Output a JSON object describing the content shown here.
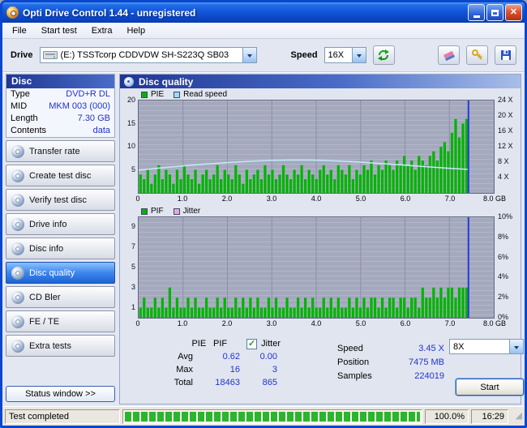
{
  "window": {
    "title": "Opti Drive Control 1.44  -  unregistered"
  },
  "menu": {
    "items": [
      "File",
      "Start test",
      "Extra",
      "Help"
    ]
  },
  "toolbar": {
    "drive_label": "Drive",
    "drive_value": "(E:)  TSSTcorp CDDVDW SH-S223Q SB03",
    "speed_label": "Speed",
    "speed_value": "16X"
  },
  "sidebar": {
    "section_header": "Disc",
    "info": [
      {
        "label": "Type",
        "value": "DVD+R DL"
      },
      {
        "label": "MID",
        "value": "MKM 003 (000)"
      },
      {
        "label": "Length",
        "value": "7.30 GB"
      },
      {
        "label": "Contents",
        "value": "data"
      }
    ],
    "buttons": [
      "Transfer rate",
      "Create test disc",
      "Verify test disc",
      "Drive info",
      "Disc info",
      "Disc quality",
      "CD Bler",
      "FE / TE",
      "Extra tests"
    ],
    "active_button": "Disc quality",
    "status_window_button": "Status window >>"
  },
  "main": {
    "header": "Disc quality"
  },
  "chart_data": [
    {
      "type": "bar",
      "legend": [
        {
          "label": "PIE",
          "color": "#00B400"
        },
        {
          "label": "Read speed",
          "color": "#9ADCF5"
        }
      ],
      "x_ticks": [
        "0",
        "1.0",
        "2.0",
        "3.0",
        "4.0",
        "5.0",
        "6.0",
        "7.0",
        "8.0 GB"
      ],
      "xlim": [
        0,
        8
      ],
      "left_max": 20,
      "left_ticks": [
        {
          "label": "20",
          "v": 20
        },
        {
          "label": "15",
          "v": 15
        },
        {
          "label": "10",
          "v": 10
        },
        {
          "label": "5",
          "v": 5
        }
      ],
      "right_max": 24,
      "right_ticks": [
        {
          "label": "24 X",
          "v": 24
        },
        {
          "label": "20 X",
          "v": 20
        },
        {
          "label": "16 X",
          "v": 16
        },
        {
          "label": "12 X",
          "v": 12
        },
        {
          "label": "8 X",
          "v": 8
        },
        {
          "label": "4 X",
          "v": 4
        }
      ],
      "bar_color": "#00B400",
      "bars": [
        4,
        3,
        5,
        2,
        4,
        6,
        3,
        5,
        4,
        2,
        5,
        3,
        6,
        4,
        3,
        5,
        2,
        4,
        5,
        3,
        4,
        6,
        3,
        5,
        4,
        3,
        6,
        4,
        2,
        5,
        3,
        4,
        5,
        3,
        6,
        4,
        5,
        3,
        4,
        6,
        4,
        3,
        5,
        4,
        6,
        3,
        5,
        4,
        3,
        5,
        6,
        4,
        5,
        3,
        6,
        5,
        4,
        6,
        3,
        5,
        4,
        6,
        5,
        7,
        4,
        6,
        5,
        7,
        6,
        5,
        7,
        6,
        8,
        6,
        7,
        5,
        8,
        7,
        6,
        8,
        9,
        7,
        10,
        11,
        9,
        13,
        16,
        12,
        15,
        16
      ],
      "bars_end_x": 7.43,
      "line": {
        "color": "#C5E9FA",
        "axis": "right",
        "points": [
          [
            0,
            5.9
          ],
          [
            0.5,
            6.5
          ],
          [
            1,
            7.0
          ],
          [
            1.5,
            7.5
          ],
          [
            2,
            7.9
          ],
          [
            2.5,
            8.2
          ],
          [
            3,
            8.45
          ],
          [
            3.5,
            8.55
          ],
          [
            4,
            8.5
          ],
          [
            4.5,
            8.3
          ],
          [
            5,
            8.0
          ],
          [
            5.5,
            7.6
          ],
          [
            6,
            7.2
          ],
          [
            6.5,
            6.8
          ],
          [
            7,
            6.4
          ],
          [
            7.43,
            6.1
          ]
        ]
      },
      "cursor_x": 7.43,
      "cursor_color": "#2638DE"
    },
    {
      "type": "bar",
      "legend": [
        {
          "label": "PIF",
          "color": "#00B400"
        },
        {
          "label": "Jitter",
          "color": "#E9A8DE"
        }
      ],
      "x_ticks": [
        "0",
        "1.0",
        "2.0",
        "3.0",
        "4.0",
        "5.0",
        "6.0",
        "7.0",
        "8.0 GB"
      ],
      "xlim": [
        0,
        8
      ],
      "left_max": 10,
      "left_ticks": [
        {
          "label": "9",
          "v": 9
        },
        {
          "label": "7",
          "v": 7
        },
        {
          "label": "5",
          "v": 5
        },
        {
          "label": "3",
          "v": 3
        },
        {
          "label": "1",
          "v": 1
        }
      ],
      "right_max": 10,
      "right_ticks": [
        {
          "label": "10%",
          "v": 10
        },
        {
          "label": "8%",
          "v": 8
        },
        {
          "label": "6%",
          "v": 6
        },
        {
          "label": "4%",
          "v": 4
        },
        {
          "label": "2%",
          "v": 2
        },
        {
          "label": "0%",
          "v": 0
        }
      ],
      "bar_color": "#00B400",
      "bars": [
        1,
        2,
        1,
        1,
        2,
        1,
        2,
        1,
        3,
        1,
        2,
        1,
        1,
        2,
        1,
        2,
        1,
        1,
        2,
        1,
        1,
        2,
        1,
        2,
        1,
        1,
        2,
        1,
        2,
        1,
        2,
        1,
        2,
        1,
        1,
        2,
        1,
        2,
        1,
        1,
        2,
        1,
        1,
        2,
        1,
        2,
        1,
        2,
        1,
        1,
        2,
        1,
        2,
        1,
        2,
        1,
        1,
        2,
        1,
        2,
        1,
        2,
        1,
        2,
        2,
        1,
        2,
        1,
        2,
        2,
        1,
        2,
        2,
        1,
        2,
        2,
        1,
        3,
        2,
        2,
        3,
        2,
        3,
        2,
        3,
        3,
        2,
        3,
        3,
        3
      ],
      "bars_end_x": 7.43,
      "cursor_x": 7.43,
      "cursor_color": "#2638DE"
    }
  ],
  "stats": {
    "col_headers": {
      "pie": "PIE",
      "pif": "PIF"
    },
    "jitter_checkbox": {
      "label": "Jitter",
      "checked": true
    },
    "rows": [
      {
        "label": "Avg",
        "pie": "0.62",
        "pif": "0.00"
      },
      {
        "label": "Max",
        "pie": "16",
        "pif": "3"
      },
      {
        "label": "Total",
        "pie": "18463",
        "pif": "865"
      }
    ],
    "speed_label": "Speed",
    "speed_value": "3.45 X",
    "write_speed_value": "8X",
    "position_label": "Position",
    "position_value": "7475 MB",
    "samples_label": "Samples",
    "samples_value": "224019",
    "start_button": "Start"
  },
  "statusbar": {
    "status": "Test completed",
    "progress_percent": 100,
    "percent": "100.0%",
    "time": "16:29"
  }
}
